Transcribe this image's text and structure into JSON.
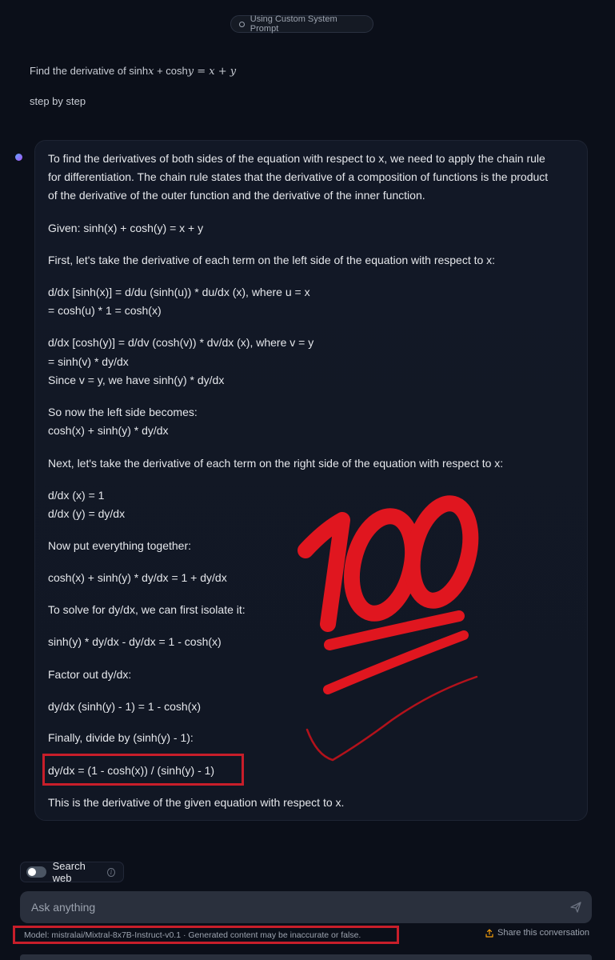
{
  "header": {
    "pill_label": "Using Custom System Prompt"
  },
  "user_message": {
    "line1_prefix": "Find the derivative of sinh",
    "line1_x": "x",
    "line1_plus": " + cosh",
    "line1_y": "y",
    "line1_eq": " = x + y",
    "line2": "step by step"
  },
  "assistant": {
    "lines": [
      "To find the derivatives of both sides of the equation with respect to x, we need to apply the chain rule",
      "for differentiation. The chain rule states that the derivative of a composition of functions is the product",
      "of the derivative of the outer function and the derivative of the inner function.",
      "Given: sinh(x) + cosh(y) = x + y",
      "First, let's take the derivative of each term on the left side of the equation with respect to x:",
      "d/dx [sinh(x)] = d/du (sinh(u)) * du/dx (x), where u = x",
      "= cosh(u) * 1 = cosh(x)",
      "d/dx [cosh(y)] = d/dv (cosh(v)) * dv/dx (x), where v = y",
      "= sinh(v) * dy/dx",
      "Since v = y, we have sinh(y) * dy/dx",
      "So now the left side becomes:",
      "cosh(x) + sinh(y) * dy/dx",
      "Next, let's take the derivative of each term on the right side of the equation with respect to x:",
      "d/dx (x) = 1",
      "d/dx (y) = dy/dx",
      "Now put everything together:",
      "cosh(x) + sinh(y) * dy/dx = 1 + dy/dx",
      "To solve for dy/dx, we can first isolate it:",
      "sinh(y) * dy/dx - dy/dx = 1 - cosh(x)",
      "Factor out dy/dx:",
      "dy/dx (sinh(y) - 1) = 1 - cosh(x)",
      "Finally, divide by (sinh(y) - 1):",
      "dy/dx = (1 - cosh(x)) / (sinh(y) - 1)",
      "This is the derivative of the given equation with respect to x."
    ],
    "sticker_text": "100"
  },
  "composer": {
    "search_web_label": "Search web",
    "search_web_enabled": false,
    "placeholder": "Ask anything",
    "model_info": "Model: mistralai/Mixtral-8x7B-Instruct-v0.1 · Generated content may be inaccurate or false.",
    "share_label": "Share this conversation"
  },
  "colors": {
    "background": "#0b0f19",
    "annotation_red": "#c81e2a",
    "sticker_red": "#e0161f"
  },
  "icons": {
    "pill": "spinner-icon",
    "send": "send-icon",
    "info": "info-icon",
    "share": "share-icon"
  }
}
